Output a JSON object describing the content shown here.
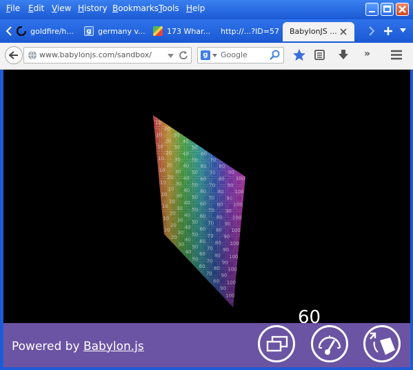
{
  "menu": [
    "File",
    "Edit",
    "View",
    "History",
    "Bookmarks",
    "Tools",
    "Help"
  ],
  "tabs": [
    {
      "label": "goldfire/h...",
      "icon": "github-icon"
    },
    {
      "label": "germany v...",
      "icon": "google-icon"
    },
    {
      "label": "173 Whar...",
      "icon": "maps-icon"
    },
    {
      "label": "http://...?ID=57",
      "icon": ""
    },
    {
      "label": "BabylonJS ...",
      "icon": "",
      "active": true
    }
  ],
  "toolbar": {
    "url": "www.babylonjs.com/sandbox/",
    "search_placeholder": "Google"
  },
  "scene": {
    "fps": "60",
    "grid_labels": [
      "10",
      "20",
      "30",
      "40",
      "50",
      "60",
      "70",
      "80",
      "90",
      "100"
    ]
  },
  "bottom_bar": {
    "powered_prefix": "Powered by ",
    "powered_link": "Babylon.js"
  },
  "colors": {
    "titlebar": "#1b59d4",
    "bottom_bar": "#6b54a3",
    "viewport": "#000000"
  }
}
